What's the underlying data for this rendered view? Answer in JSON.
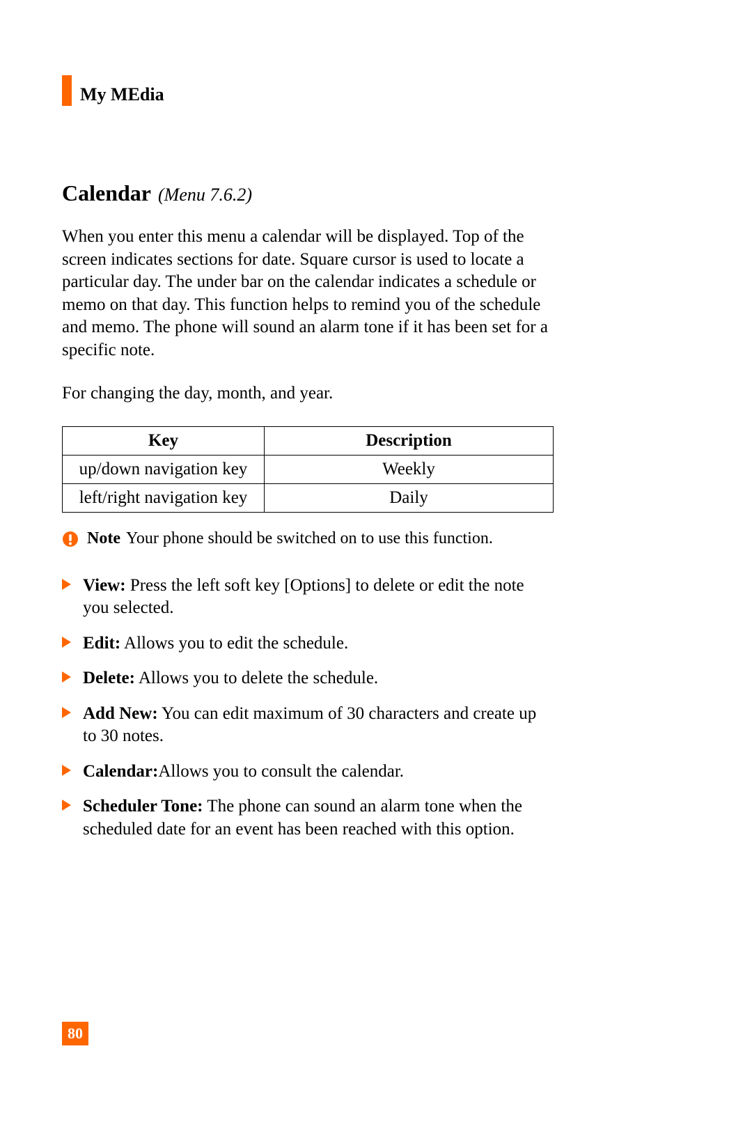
{
  "header": {
    "section": "My MEdia"
  },
  "title": {
    "main": "Calendar",
    "sub": "(Menu 7.6.2)"
  },
  "paragraphs": {
    "p1": "When you enter this menu a calendar will be displayed. Top of the screen indicates sections for date. Square cursor is used to locate a particular day. The under bar on the calendar indicates a schedule or memo on that day. This function helps to remind you of the schedule and memo. The phone will sound an alarm tone if it has been set for a specific note.",
    "p2": "For changing the day, month, and year."
  },
  "table": {
    "headers": {
      "key": "Key",
      "description": "Description"
    },
    "rows": [
      {
        "key": "up/down navigation key",
        "description": "Weekly"
      },
      {
        "key": "left/right navigation key",
        "description": "Daily"
      }
    ]
  },
  "note": {
    "label": "Note",
    "text": "Your phone should be switched on to use this function."
  },
  "bullets": [
    {
      "label": "View:",
      "text": " Press the left soft key [Options] to delete or edit the note you selected."
    },
    {
      "label": "Edit:",
      "text": " Allows you to edit the schedule."
    },
    {
      "label": "Delete:",
      "text": " Allows you to delete the schedule."
    },
    {
      "label": "Add New:",
      "text": " You can edit maximum of 30 characters and create up to 30 notes."
    },
    {
      "label": "Calendar:",
      "text": "Allows you to consult the calendar."
    },
    {
      "label": "Scheduler Tone:",
      "text": " The phone can sound an alarm tone when the scheduled date for an event has been reached with this option."
    }
  ],
  "pageNumber": "80"
}
